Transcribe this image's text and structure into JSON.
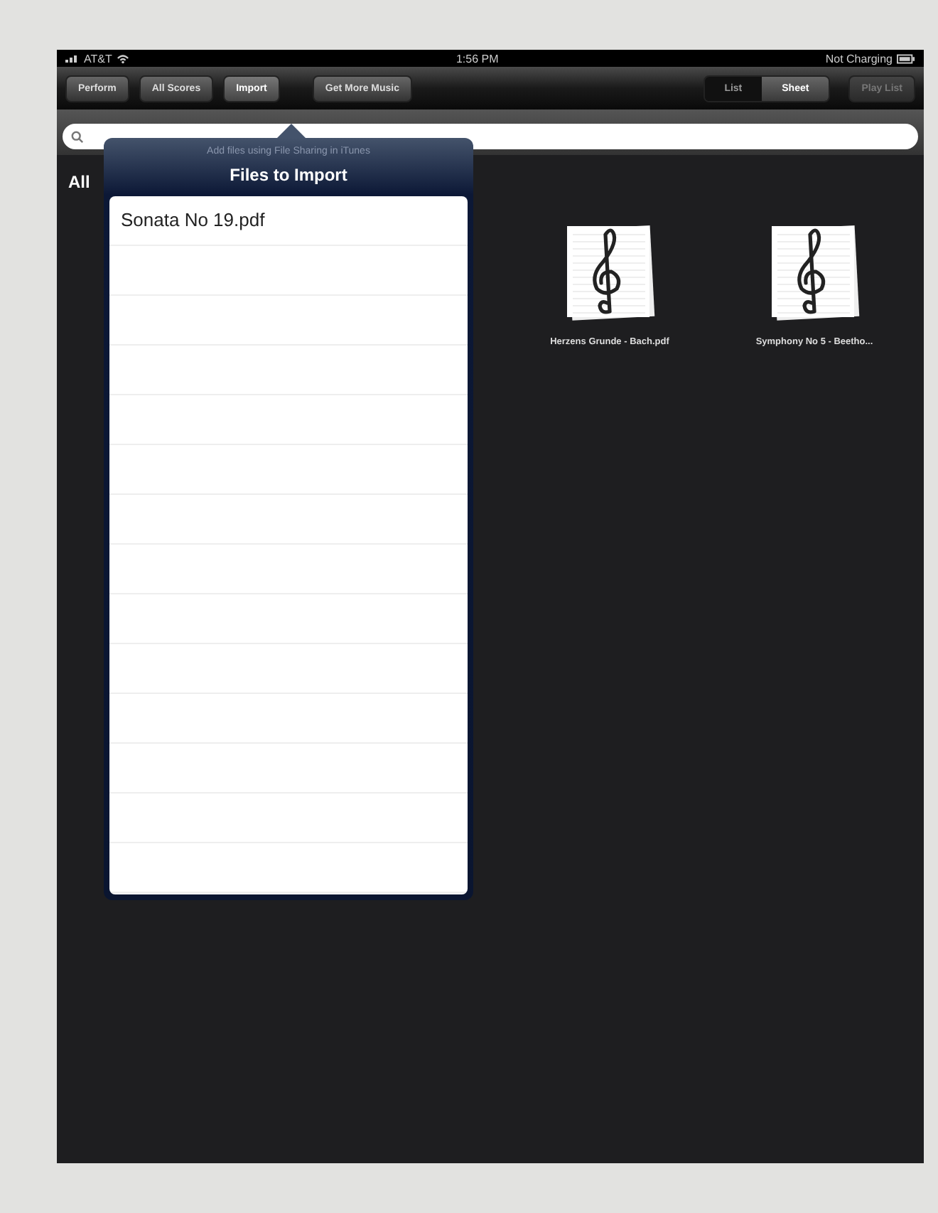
{
  "status_bar": {
    "carrier": "AT&T",
    "time": "1:56 PM",
    "battery": "Not Charging"
  },
  "toolbar": {
    "buttons": [
      {
        "label": "Perform",
        "selected": false
      },
      {
        "label": "All Scores",
        "selected": false
      },
      {
        "label": "Import",
        "selected": true
      },
      {
        "label": "Get More Music",
        "selected": false
      }
    ],
    "view_toggle": [
      {
        "label": "List",
        "selected": false
      },
      {
        "label": "Sheet",
        "selected": true
      }
    ],
    "play_list": {
      "label": "Play List",
      "disabled": true
    }
  },
  "section_title": "All",
  "popover": {
    "hint": "Add files using File Sharing in iTunes",
    "title": "Files to Import",
    "files": [
      {
        "name": "Sonata No 19.pdf"
      }
    ]
  },
  "scores": [
    {
      "name": "Herzens Grunde - Bach.pdf"
    },
    {
      "name": "Symphony No 5 - Beetho..."
    }
  ]
}
